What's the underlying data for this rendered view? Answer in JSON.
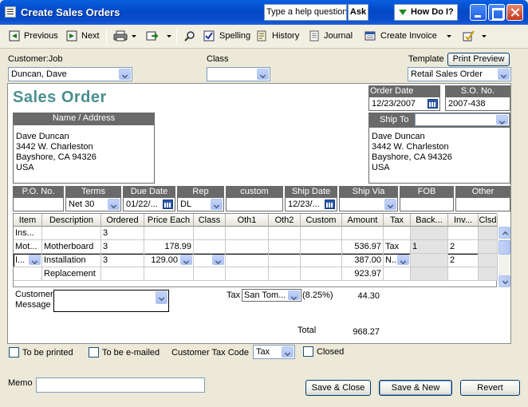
{
  "window": {
    "title": "Create Sales Orders",
    "help_placeholder": "Type a help question",
    "ask_label": "Ask",
    "how_do_i_label": "How Do I?"
  },
  "toolbar": {
    "previous": "Previous",
    "next": "Next",
    "spelling": "Spelling",
    "history": "History",
    "journal": "Journal",
    "create_invoice": "Create Invoice"
  },
  "header": {
    "customer_job_label": "Customer:Job",
    "customer_job_value": "Duncan, Dave",
    "class_label": "Class",
    "class_value": "",
    "template_label": "Template",
    "print_preview_label": "Print Preview",
    "template_value": "Retail Sales Order"
  },
  "form": {
    "title": "Sales Order",
    "order_date_label": "Order Date",
    "order_date": "12/23/2007",
    "so_no_label": "S.O. No.",
    "so_no": "2007-438",
    "name_address_label": "Name / Address",
    "bill_to": [
      "Dave Duncan",
      "3442 W. Charleston",
      "Bayshore, CA  94326",
      "USA"
    ],
    "ship_to_label": "Ship To",
    "ship_to_value": "",
    "ship_to": [
      "Dave Duncan",
      "3442 W. Charleston",
      "Bayshore, CA  94326",
      "USA"
    ]
  },
  "info_fields": {
    "labels": [
      "P.O. No.",
      "Terms",
      "Due Date",
      "Rep",
      "custom",
      "Ship Date",
      "Ship Via",
      "FOB",
      "Other"
    ],
    "po_no": "",
    "terms": "Net 30",
    "due_date": "01/22/...",
    "rep": "DL",
    "custom": "",
    "ship_date": "12/23/...",
    "ship_via": "",
    "fob": "",
    "other": ""
  },
  "grid": {
    "columns": [
      "Item",
      "Description",
      "Ordered",
      "Price Each",
      "Class",
      "Oth1",
      "Oth2",
      "Custom",
      "Amount",
      "Tax",
      "Back...",
      "Inv...",
      "Clsd"
    ],
    "rows": [
      {
        "item": "Ins...",
        "description": "",
        "ordered": "3",
        "price": "",
        "class": "",
        "oth1": "",
        "oth2": "",
        "custom": "",
        "amount": "",
        "tax": "",
        "back": "",
        "inv": ""
      },
      {
        "item": "Mot...",
        "description": "Motherboard",
        "ordered": "3",
        "price": "178.99",
        "class": "",
        "oth1": "",
        "oth2": "",
        "custom": "",
        "amount": "536.97",
        "tax": "Tax",
        "back": "1",
        "inv": "2"
      },
      {
        "item": "I...",
        "description": "Installation",
        "ordered": "3",
        "price": "129.00",
        "class": "",
        "oth1": "",
        "oth2": "",
        "custom": "",
        "amount": "387.00",
        "tax": "N...",
        "back": "",
        "inv": "2"
      },
      {
        "item": "",
        "description": "Replacement",
        "ordered": "",
        "price": "",
        "class": "",
        "oth1": "",
        "oth2": "",
        "custom": "",
        "amount": "923.97",
        "tax": "",
        "back": "",
        "inv": ""
      }
    ]
  },
  "footer": {
    "customer_message_label_1": "Customer",
    "customer_message_label_2": "Message",
    "customer_message_value": "",
    "tax_label": "Tax",
    "tax_item": "San Tom...",
    "tax_rate": "(8.25%)",
    "tax_amount": "44.30",
    "total_label": "Total",
    "total_amount": "968.27"
  },
  "bottom": {
    "to_be_printed": "To be printed",
    "to_be_emailed": "To be e-mailed",
    "customer_tax_code_label": "Customer Tax Code",
    "customer_tax_code": "Tax",
    "closed_label": "Closed",
    "memo_label": "Memo",
    "memo_value": "",
    "save_close": "Save & Close",
    "save_new": "Save & New",
    "revert": "Revert"
  },
  "colors": {
    "title_bar": "#0A5FE0",
    "form_title": "#4A8F8F",
    "field_header": "#6A6A6A",
    "window_background": "#ECE9D8"
  }
}
